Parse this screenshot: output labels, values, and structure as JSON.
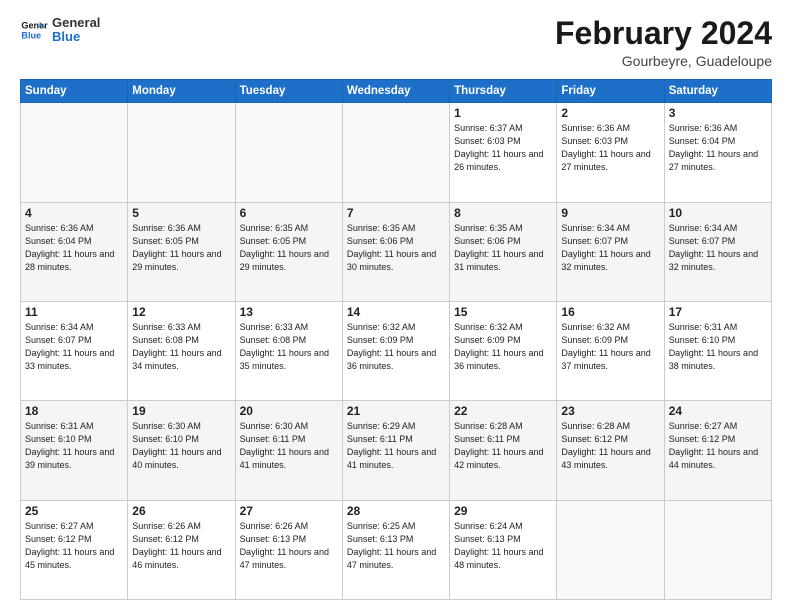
{
  "header": {
    "logo_line1": "General",
    "logo_line2": "Blue",
    "month_title": "February 2024",
    "location": "Gourbeyre, Guadeloupe"
  },
  "days_of_week": [
    "Sunday",
    "Monday",
    "Tuesday",
    "Wednesday",
    "Thursday",
    "Friday",
    "Saturday"
  ],
  "weeks": [
    [
      {
        "num": "",
        "info": ""
      },
      {
        "num": "",
        "info": ""
      },
      {
        "num": "",
        "info": ""
      },
      {
        "num": "",
        "info": ""
      },
      {
        "num": "1",
        "info": "Sunrise: 6:37 AM\nSunset: 6:03 PM\nDaylight: 11 hours\nand 26 minutes."
      },
      {
        "num": "2",
        "info": "Sunrise: 6:36 AM\nSunset: 6:03 PM\nDaylight: 11 hours\nand 27 minutes."
      },
      {
        "num": "3",
        "info": "Sunrise: 6:36 AM\nSunset: 6:04 PM\nDaylight: 11 hours\nand 27 minutes."
      }
    ],
    [
      {
        "num": "4",
        "info": "Sunrise: 6:36 AM\nSunset: 6:04 PM\nDaylight: 11 hours\nand 28 minutes."
      },
      {
        "num": "5",
        "info": "Sunrise: 6:36 AM\nSunset: 6:05 PM\nDaylight: 11 hours\nand 29 minutes."
      },
      {
        "num": "6",
        "info": "Sunrise: 6:35 AM\nSunset: 6:05 PM\nDaylight: 11 hours\nand 29 minutes."
      },
      {
        "num": "7",
        "info": "Sunrise: 6:35 AM\nSunset: 6:06 PM\nDaylight: 11 hours\nand 30 minutes."
      },
      {
        "num": "8",
        "info": "Sunrise: 6:35 AM\nSunset: 6:06 PM\nDaylight: 11 hours\nand 31 minutes."
      },
      {
        "num": "9",
        "info": "Sunrise: 6:34 AM\nSunset: 6:07 PM\nDaylight: 11 hours\nand 32 minutes."
      },
      {
        "num": "10",
        "info": "Sunrise: 6:34 AM\nSunset: 6:07 PM\nDaylight: 11 hours\nand 32 minutes."
      }
    ],
    [
      {
        "num": "11",
        "info": "Sunrise: 6:34 AM\nSunset: 6:07 PM\nDaylight: 11 hours\nand 33 minutes."
      },
      {
        "num": "12",
        "info": "Sunrise: 6:33 AM\nSunset: 6:08 PM\nDaylight: 11 hours\nand 34 minutes."
      },
      {
        "num": "13",
        "info": "Sunrise: 6:33 AM\nSunset: 6:08 PM\nDaylight: 11 hours\nand 35 minutes."
      },
      {
        "num": "14",
        "info": "Sunrise: 6:32 AM\nSunset: 6:09 PM\nDaylight: 11 hours\nand 36 minutes."
      },
      {
        "num": "15",
        "info": "Sunrise: 6:32 AM\nSunset: 6:09 PM\nDaylight: 11 hours\nand 36 minutes."
      },
      {
        "num": "16",
        "info": "Sunrise: 6:32 AM\nSunset: 6:09 PM\nDaylight: 11 hours\nand 37 minutes."
      },
      {
        "num": "17",
        "info": "Sunrise: 6:31 AM\nSunset: 6:10 PM\nDaylight: 11 hours\nand 38 minutes."
      }
    ],
    [
      {
        "num": "18",
        "info": "Sunrise: 6:31 AM\nSunset: 6:10 PM\nDaylight: 11 hours\nand 39 minutes."
      },
      {
        "num": "19",
        "info": "Sunrise: 6:30 AM\nSunset: 6:10 PM\nDaylight: 11 hours\nand 40 minutes."
      },
      {
        "num": "20",
        "info": "Sunrise: 6:30 AM\nSunset: 6:11 PM\nDaylight: 11 hours\nand 41 minutes."
      },
      {
        "num": "21",
        "info": "Sunrise: 6:29 AM\nSunset: 6:11 PM\nDaylight: 11 hours\nand 41 minutes."
      },
      {
        "num": "22",
        "info": "Sunrise: 6:28 AM\nSunset: 6:11 PM\nDaylight: 11 hours\nand 42 minutes."
      },
      {
        "num": "23",
        "info": "Sunrise: 6:28 AM\nSunset: 6:12 PM\nDaylight: 11 hours\nand 43 minutes."
      },
      {
        "num": "24",
        "info": "Sunrise: 6:27 AM\nSunset: 6:12 PM\nDaylight: 11 hours\nand 44 minutes."
      }
    ],
    [
      {
        "num": "25",
        "info": "Sunrise: 6:27 AM\nSunset: 6:12 PM\nDaylight: 11 hours\nand 45 minutes."
      },
      {
        "num": "26",
        "info": "Sunrise: 6:26 AM\nSunset: 6:12 PM\nDaylight: 11 hours\nand 46 minutes."
      },
      {
        "num": "27",
        "info": "Sunrise: 6:26 AM\nSunset: 6:13 PM\nDaylight: 11 hours\nand 47 minutes."
      },
      {
        "num": "28",
        "info": "Sunrise: 6:25 AM\nSunset: 6:13 PM\nDaylight: 11 hours\nand 47 minutes."
      },
      {
        "num": "29",
        "info": "Sunrise: 6:24 AM\nSunset: 6:13 PM\nDaylight: 11 hours\nand 48 minutes."
      },
      {
        "num": "",
        "info": ""
      },
      {
        "num": "",
        "info": ""
      }
    ]
  ]
}
